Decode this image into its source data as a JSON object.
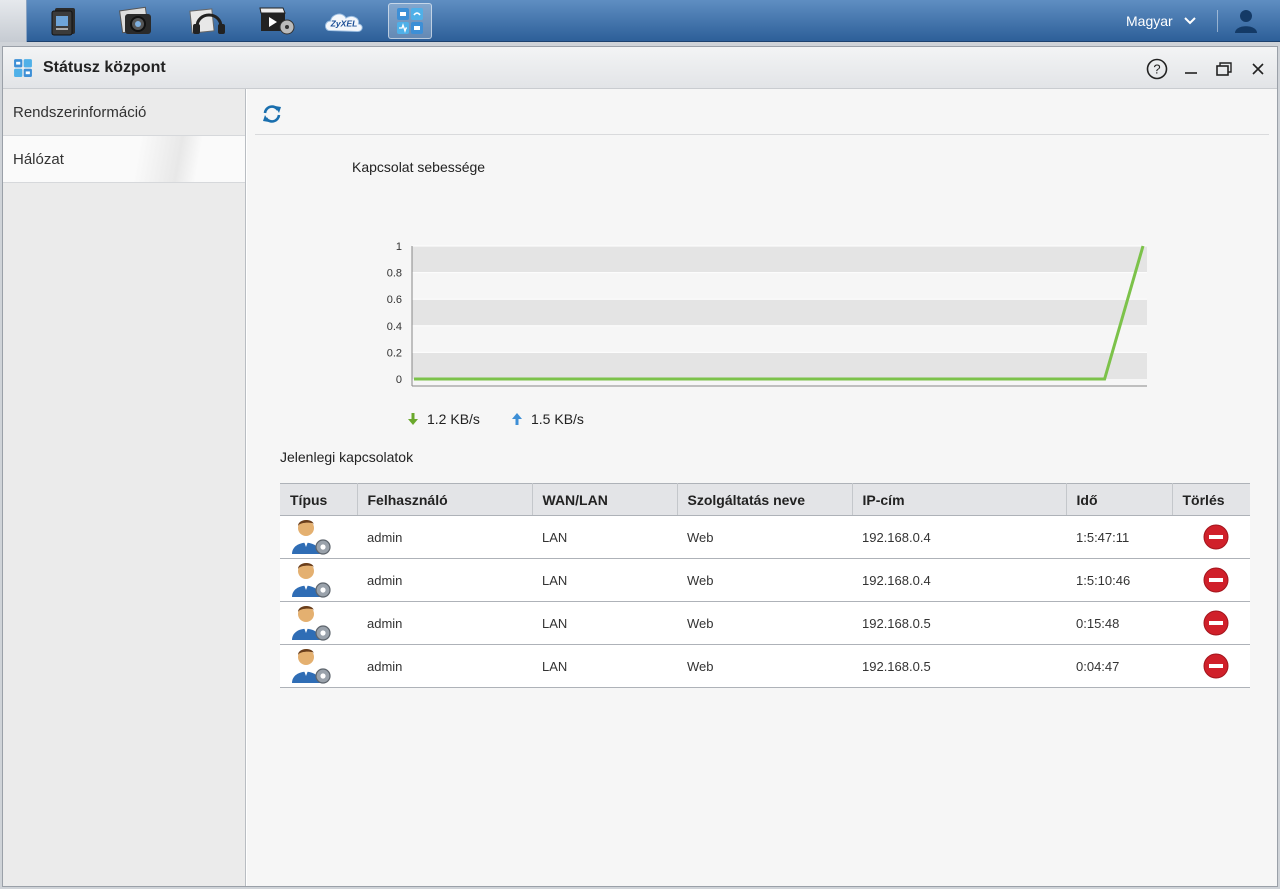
{
  "taskbar": {
    "apps": [
      {
        "icon": "file-browser-icon"
      },
      {
        "icon": "photo-icon"
      },
      {
        "icon": "music-icon"
      },
      {
        "icon": "video-icon"
      },
      {
        "icon": "zyxel-cloud-icon",
        "label": "ZyXEL"
      },
      {
        "icon": "status-center-icon",
        "active": true
      }
    ],
    "language": "Magyar"
  },
  "window": {
    "title": "Státusz központ"
  },
  "sidebar": {
    "items": [
      {
        "label": "Rendszerinformáció",
        "selected": false
      },
      {
        "label": "Hálózat",
        "selected": true
      }
    ]
  },
  "chart_data": {
    "type": "line",
    "title": "Kapcsolat sebessége",
    "yticks": [
      "1",
      "0.8",
      "0.6",
      "0.4",
      "0.2",
      "0"
    ],
    "ylim": [
      0,
      1
    ],
    "grid": true,
    "series": [
      {
        "color": "#7cc24a",
        "values": [
          0,
          0,
          0,
          0,
          0,
          0,
          0,
          0,
          0,
          0,
          0,
          0,
          0,
          0,
          0,
          0,
          0,
          0,
          0,
          1
        ]
      }
    ],
    "download": "1.2 KB/s",
    "upload": "1.5 KB/s"
  },
  "connections": {
    "title": "Jelenlegi kapcsolatok",
    "columns": [
      "Típus",
      "Felhasználó",
      "WAN/LAN",
      "Szolgáltatás neve",
      "IP-cím",
      "Idő",
      "Törlés"
    ],
    "rows": [
      {
        "user": "admin",
        "wanlan": "LAN",
        "service": "Web",
        "ip": "192.168.0.4",
        "time": "1:5:47:11"
      },
      {
        "user": "admin",
        "wanlan": "LAN",
        "service": "Web",
        "ip": "192.168.0.4",
        "time": "1:5:10:46"
      },
      {
        "user": "admin",
        "wanlan": "LAN",
        "service": "Web",
        "ip": "192.168.0.5",
        "time": "0:15:48"
      },
      {
        "user": "admin",
        "wanlan": "LAN",
        "service": "Web",
        "ip": "192.168.0.5",
        "time": "0:04:47"
      }
    ]
  },
  "colors": {
    "taskbar": "#3d6ea8",
    "accent": "#1a6fae",
    "line": "#7cc24a",
    "delete": "#d0202a"
  }
}
